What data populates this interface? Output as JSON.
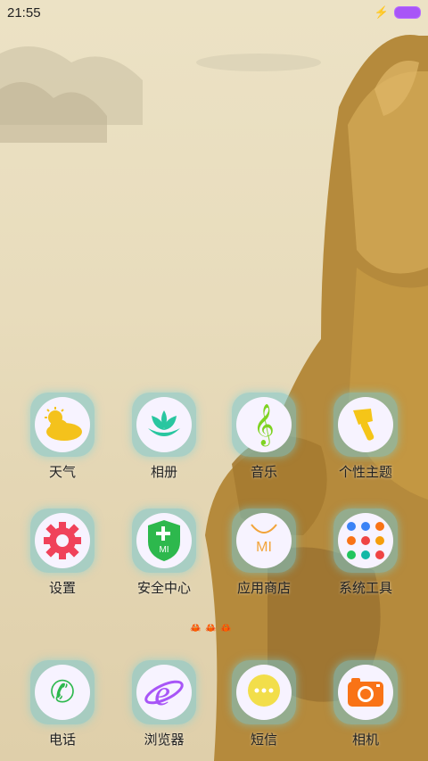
{
  "status_bar": {
    "time": "21:55",
    "charging_icon": "bolt-icon",
    "battery_color": "#a855f7"
  },
  "apps": [
    {
      "label": "天气",
      "icon": "weather-icon"
    },
    {
      "label": "相册",
      "icon": "gallery-icon"
    },
    {
      "label": "音乐",
      "icon": "music-icon"
    },
    {
      "label": "个性主题",
      "icon": "themes-icon"
    },
    {
      "label": "设置",
      "icon": "settings-icon"
    },
    {
      "label": "安全中心",
      "icon": "security-icon"
    },
    {
      "label": "应用商店",
      "icon": "app-store-icon"
    },
    {
      "label": "系统工具",
      "icon": "folder-icon"
    }
  ],
  "app_store_icon_text": "MI",
  "security_icon_text": "MI",
  "dock": [
    {
      "label": "电话",
      "icon": "phone-icon"
    },
    {
      "label": "浏览器",
      "icon": "browser-icon"
    },
    {
      "label": "短信",
      "icon": "messages-icon"
    },
    {
      "label": "相机",
      "icon": "camera-icon"
    }
  ]
}
